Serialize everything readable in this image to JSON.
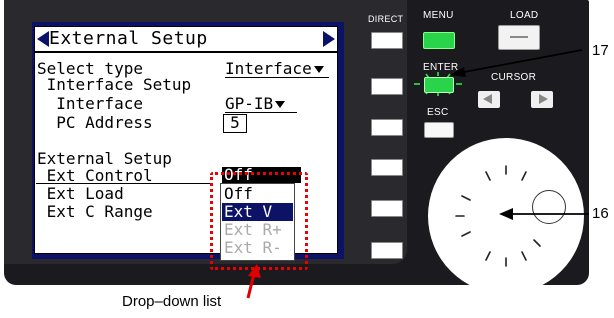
{
  "screen": {
    "title": "External Setup",
    "rows": [
      {
        "label": "Select type",
        "value": "Interface"
      },
      {
        "label": " Interface Setup"
      },
      {
        "label": "  Interface",
        "value": "GP-IB"
      },
      {
        "label": "  PC Address",
        "value": "5"
      },
      {
        "label": "External Setup"
      },
      {
        "label": " Ext Control",
        "value": "Off"
      },
      {
        "label": " Ext Load"
      },
      {
        "label": " Ext C Range"
      }
    ],
    "dropdown_options": [
      {
        "label": "Off",
        "state": "normal"
      },
      {
        "label": "Ext V",
        "state": "highlighted"
      },
      {
        "label": "Ext R+",
        "state": "disabled"
      },
      {
        "label": "Ext R-",
        "state": "disabled"
      }
    ]
  },
  "panel": {
    "direct_label": "DIRECT",
    "menu_label": "MENU",
    "load_label": "LOAD",
    "enter_label": "ENTER",
    "cursor_label": "CURSOR",
    "esc_label": "ESC"
  },
  "callouts": {
    "enter_num": "17",
    "knob_num": "16",
    "dropdown_caption": "Drop–down list"
  },
  "colors": {
    "lcd_bg": "#0c1266",
    "panel_bg": "#1b1b1f",
    "menu_led": "#29d44a",
    "callout_red": "#e00000"
  }
}
